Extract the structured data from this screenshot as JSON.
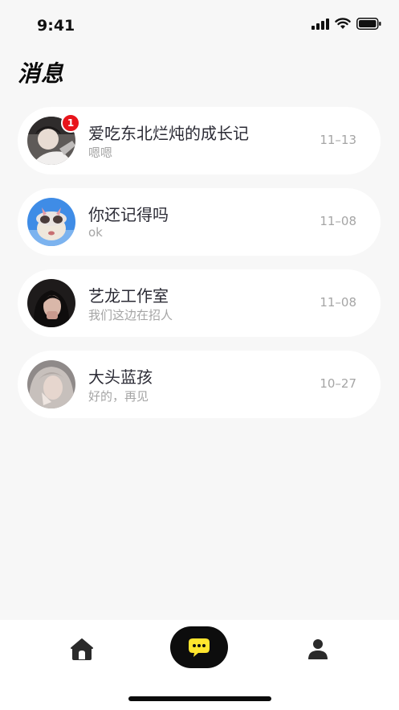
{
  "status_bar": {
    "time": "9:41"
  },
  "page": {
    "title": "消息"
  },
  "chats": [
    {
      "name": "爱吃东北烂炖的成长记",
      "preview": "嗯嗯",
      "date": "11–13",
      "unread": "1"
    },
    {
      "name": "你还记得吗",
      "preview": "ok",
      "date": "11–08"
    },
    {
      "name": "艺龙工作室",
      "preview": "我们这边在招人",
      "date": "11–08"
    },
    {
      "name": "大头蓝孩",
      "preview": "好的，再见",
      "date": "10–27"
    }
  ],
  "tab_bar": {
    "tabs": [
      {
        "icon": "home-icon"
      },
      {
        "icon": "chat-bubble-icon",
        "active": true,
        "accent": "#ffe52e"
      },
      {
        "icon": "person-icon"
      }
    ]
  },
  "colors": {
    "background": "#f7f7f7",
    "badge": "#e8141b",
    "active_tab": "#0d0d0d",
    "accent": "#ffe52e"
  }
}
